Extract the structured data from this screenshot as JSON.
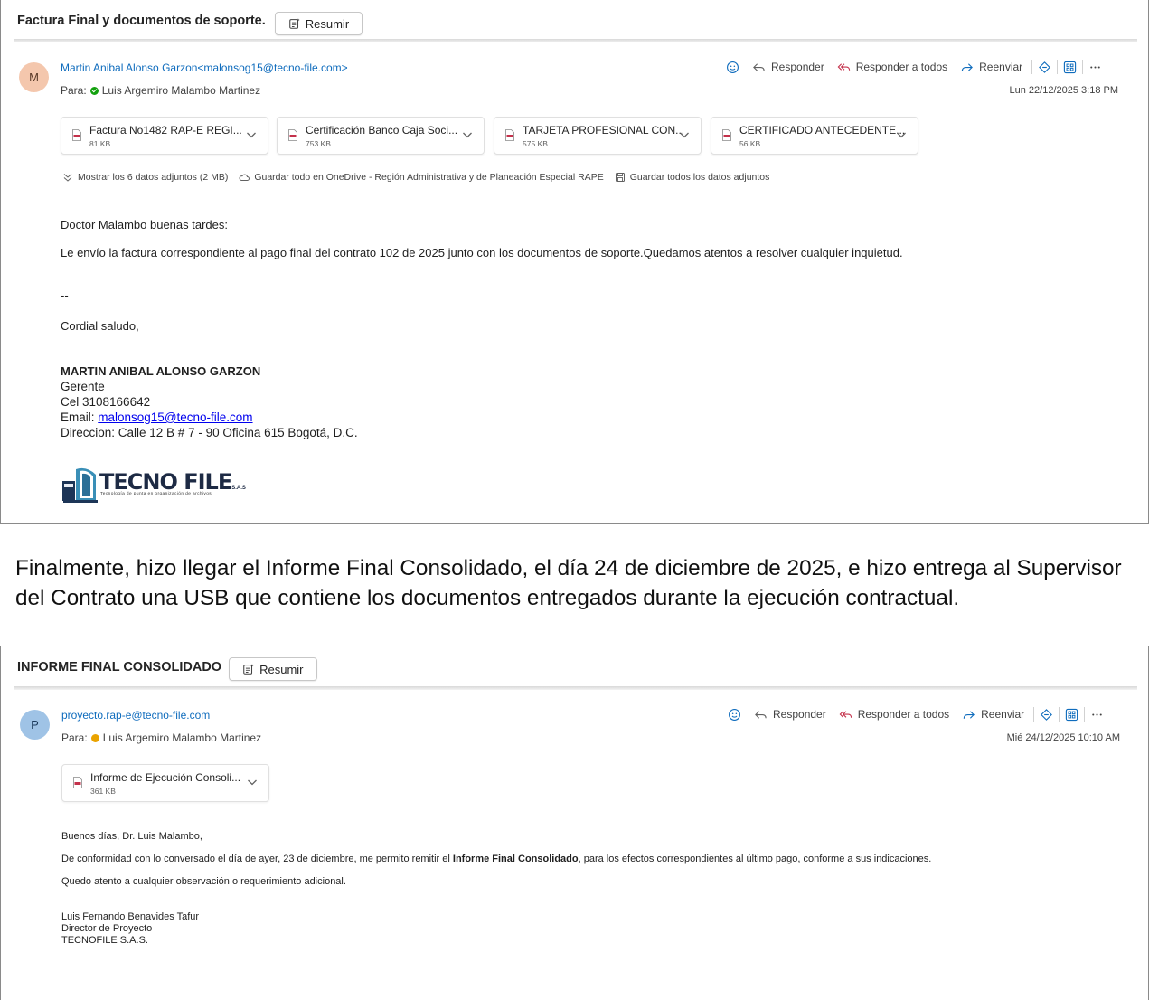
{
  "email1": {
    "subject": "Factura Final y documentos de soporte.",
    "summarize_label": "Resumir",
    "avatar_initial": "M",
    "from": "Martin Anibal Alonso Garzon<malonsog15@tecno-file.com>",
    "to_prefix": "Para:",
    "to": "Luis Argemiro Malambo Martinez",
    "presence": "available",
    "toolbar": {
      "reply": "Responder",
      "reply_all": "Responder a todos",
      "forward": "Reenviar"
    },
    "date": "Lun 22/12/2025 3:18 PM",
    "attachments": [
      {
        "name": "Factura No1482 RAP-E REGI...",
        "size": "81 KB"
      },
      {
        "name": "Certificación Banco Caja Soci...",
        "size": "753 KB"
      },
      {
        "name": "TARJETA PROFESIONAL CON...",
        "size": "575 KB"
      },
      {
        "name": "CERTIFICADO ANTECEDENTE...",
        "size": "56 KB"
      }
    ],
    "attachment_actions": {
      "show_all": "Mostrar los 6 datos adjuntos (2 MB)",
      "save_onedrive": "Guardar todo en OneDrive - Región Administrativa y de Planeación Especial RAPE",
      "save_all": "Guardar todos los datos adjuntos"
    },
    "greeting": "Doctor Malambo buenas tardes:",
    "body": "Le envío la factura correspondiente al pago final del contrato 102 de 2025 junto con los documentos de soporte.Quedamos atentos a resolver cualquier inquietud.",
    "sig_dash": "--",
    "closing": "Cordial saludo,",
    "signature": {
      "name": "MARTIN ANIBAL ALONSO GARZON",
      "title": "Gerente",
      "phone": "Cel 3108166642",
      "email_label": "Email: ",
      "email": "malonsog15@tecno-file.com",
      "address": "Direccion: Calle 12 B # 7 - 90 Oficina 615 Bogotá, D.C."
    },
    "logo": {
      "text": "TECNO FILE",
      "suffix": "S.A.S",
      "tagline": "Tecnología de punta en organización de archivos"
    }
  },
  "narrative": "Finalmente, hizo llegar el Informe Final Consolidado, el día 24 de diciembre de 2025, e hizo entrega al Supervisor del Contrato una USB que contiene los documentos entregados durante la ejecución contractual.",
  "email2": {
    "subject": "INFORME FINAL CONSOLIDADO",
    "summarize_label": "Resumir",
    "avatar_initial": "P",
    "from": "proyecto.rap-e@tecno-file.com",
    "to_prefix": "Para:",
    "to": "Luis Argemiro Malambo Martinez",
    "presence": "away",
    "toolbar": {
      "reply": "Responder",
      "reply_all": "Responder a todos",
      "forward": "Reenviar"
    },
    "date": "Mié 24/12/2025 10:10 AM",
    "attachments": [
      {
        "name": "Informe de Ejecución Consoli...",
        "size": "361 KB"
      }
    ],
    "greeting": "Buenos días, Dr. Luis Malambo,",
    "body_before": "De conformidad con lo conversado el día de ayer, 23 de diciembre, me permito remitir el ",
    "body_bold": "Informe Final Consolidado",
    "body_after": ", para los efectos correspondientes al último pago, conforme a sus indicaciones.",
    "line3": "Quedo atento a cualquier observación o requerimiento adicional.",
    "signature": {
      "name": "Luis Fernando Benavides Tafur",
      "title": "Director de Proyecto",
      "company": "TECNOFILE S.A.S."
    }
  },
  "colors": {
    "link": "#0f6cbd",
    "avatar_m": "#f4c7ad",
    "avatar_p": "#9fc3e6",
    "presence_green": "#13a10e",
    "presence_away": "#eaa300",
    "pdf_red": "#c4314b",
    "toolbar_icon": "#0f6cbd"
  }
}
